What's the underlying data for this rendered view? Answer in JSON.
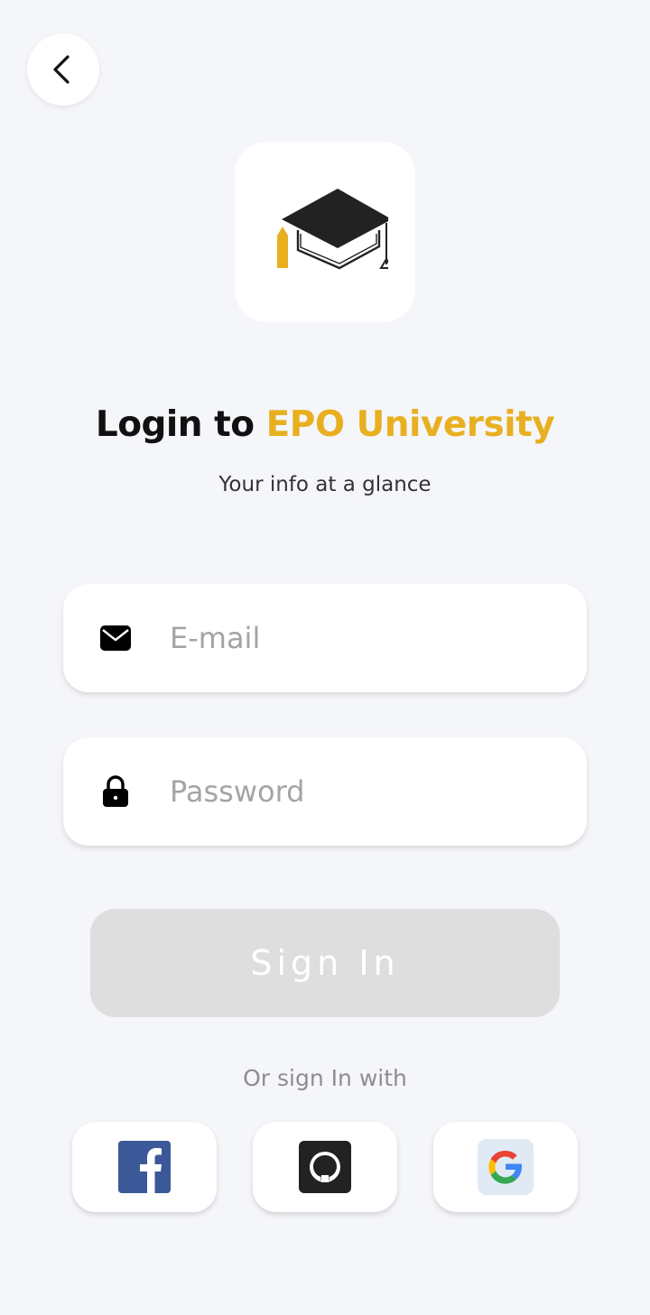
{
  "header": {
    "back_icon": "chevron-left-icon"
  },
  "logo": {
    "icon": "graduation-cap-icon",
    "accent_color": "#e8b020"
  },
  "title": {
    "prefix": "Login to",
    "brand": "EPO University"
  },
  "subtitle": "Your info at a glance",
  "form": {
    "email": {
      "placeholder": "E-mail",
      "value": "",
      "icon": "mail-icon"
    },
    "password": {
      "placeholder": "Password",
      "value": "",
      "icon": "lock-icon"
    },
    "submit_label": "Sign In",
    "submit_color": "#dedede"
  },
  "social": {
    "label": "Or sign In with",
    "providers": [
      {
        "name": "Facebook",
        "icon": "facebook-icon",
        "color": "#3b5998"
      },
      {
        "name": "GitHub",
        "icon": "github-icon",
        "color": "#222222"
      },
      {
        "name": "Google",
        "icon": "google-icon",
        "color": "#4285f4"
      }
    ]
  }
}
